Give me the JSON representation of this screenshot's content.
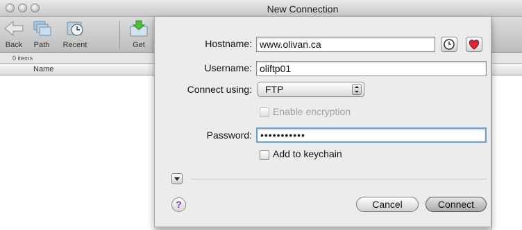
{
  "window": {
    "title": "New Connection"
  },
  "toolbar": {
    "items": [
      {
        "label": "Back",
        "icon": "back-arrow-icon"
      },
      {
        "label": "Path",
        "icon": "path-folders-icon"
      },
      {
        "label": "Recent",
        "icon": "recent-clock-icon"
      },
      {
        "label": "Get",
        "icon": "get-download-icon"
      }
    ]
  },
  "browser": {
    "status": "0 items",
    "column_name": "Name"
  },
  "form": {
    "hostname_label": "Hostname:",
    "hostname_value": "www.olivan.ca",
    "username_label": "Username:",
    "username_value": "oliftp01",
    "connect_label": "Connect using:",
    "connect_value": "FTP",
    "encryption_label": "Enable encryption",
    "password_label": "Password:",
    "password_value": "•••••••••••",
    "keychain_label": "Add to keychain"
  },
  "buttons": {
    "cancel": "Cancel",
    "connect": "Connect",
    "help": "?"
  },
  "colors": {
    "accent_heart": "#d8263a",
    "help_purple": "#7a3fb3",
    "focus_ring": "#6aa0d8"
  }
}
